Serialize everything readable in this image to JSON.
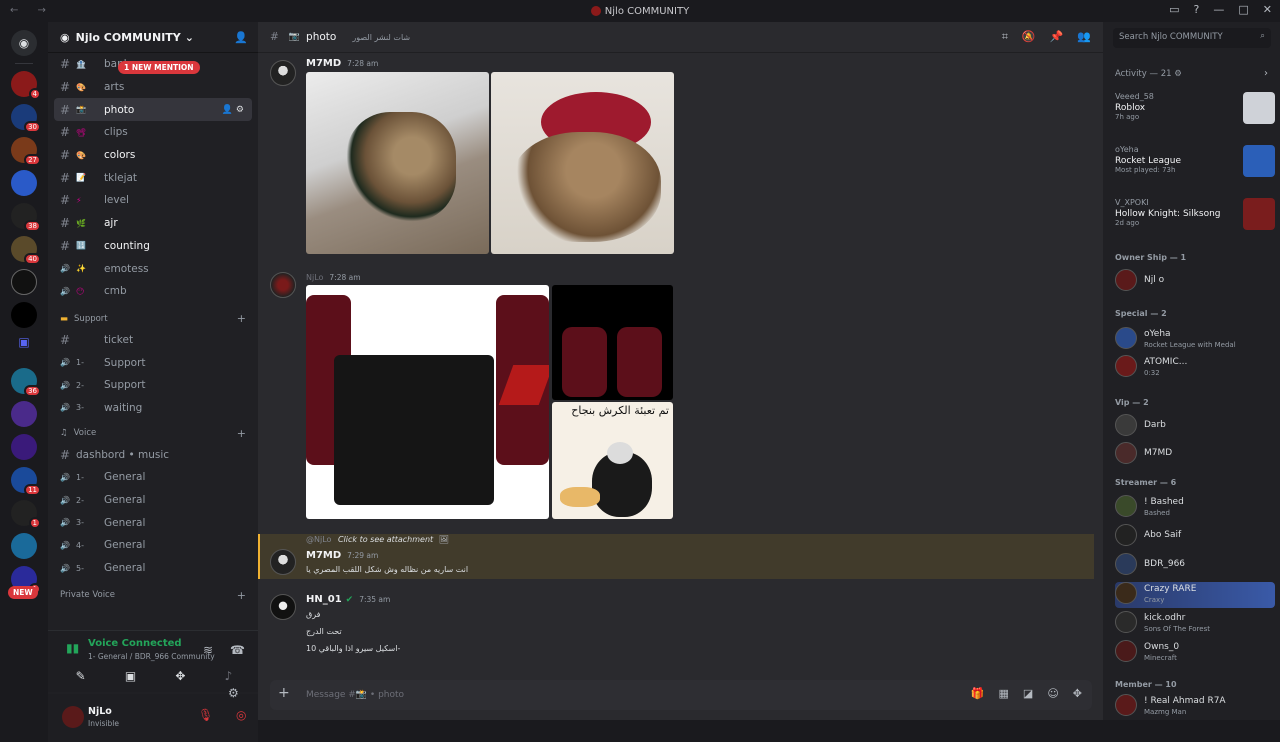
{
  "titlebar": {
    "title": "Njlo COMMUNITY"
  },
  "guild": {
    "name": "Njlo COMMUNITY"
  },
  "pills": {
    "mention": "1 NEW MENTION",
    "new": "NEW"
  },
  "channels": [
    {
      "label": "bank",
      "emoji": "🏦",
      "kind": "text",
      "state": ""
    },
    {
      "label": "arts",
      "emoji": "🎨",
      "kind": "text",
      "state": ""
    },
    {
      "label": "photo",
      "emoji": "📸",
      "kind": "text",
      "state": "sel"
    },
    {
      "label": "clips",
      "emoji": "📽",
      "kind": "text",
      "state": ""
    },
    {
      "label": "colors",
      "emoji": "🎨",
      "kind": "text",
      "state": "bold"
    },
    {
      "label": "tklejat",
      "emoji": "📝",
      "kind": "text",
      "state": ""
    },
    {
      "label": "level",
      "emoji": "⚡",
      "kind": "text",
      "state": ""
    },
    {
      "label": "ajr",
      "emoji": "🌿",
      "kind": "text",
      "state": "bold"
    },
    {
      "label": "counting",
      "emoji": "🔢",
      "kind": "text",
      "state": "bold"
    },
    {
      "label": "emotess",
      "emoji": "✨",
      "kind": "voice",
      "state": ""
    },
    {
      "label": "cmb",
      "emoji": "😶",
      "kind": "voice",
      "state": ""
    }
  ],
  "support_category": {
    "label": "Support"
  },
  "support_channels": [
    {
      "label": "ticket",
      "kind": "text"
    },
    {
      "label": "Support",
      "prefix": "1-",
      "kind": "voice"
    },
    {
      "label": "Support",
      "prefix": "2-",
      "kind": "voice"
    },
    {
      "label": "waiting",
      "prefix": "3-",
      "kind": "voice"
    }
  ],
  "voice_category": {
    "label": "Voice"
  },
  "voice_channels": [
    {
      "label": "dashbord • music"
    },
    {
      "label": "General",
      "prefix": "1-"
    },
    {
      "label": "General",
      "prefix": "2-"
    },
    {
      "label": "General",
      "prefix": "3-"
    },
    {
      "label": "General",
      "prefix": "4-"
    },
    {
      "label": "General",
      "prefix": "5-"
    }
  ],
  "private_voice": {
    "label": "Private Voice"
  },
  "voice_connected": {
    "title": "Voice Connected",
    "subtitle": "1- General / BDR_966 Community"
  },
  "user": {
    "name": "NjLo",
    "status": "Invisible"
  },
  "header": {
    "channel": "photo",
    "topic": "شات لنشر الصور"
  },
  "search": {
    "placeholder": "Search Njlo COMMUNITY"
  },
  "messages": [
    {
      "author": "M7MD",
      "time": "7:28 am"
    },
    {
      "author": "NjLo",
      "time": "7:28 am"
    },
    {
      "author": "M7MD",
      "time": "7:29 am",
      "reply": "Click to see attachment",
      "reply_author": "@NjLo",
      "text": "انت ساريه من نظاله وش شكل اللقب المصري يا"
    },
    {
      "author": "HN_01",
      "time": "7:35 am",
      "lines": [
        "فرق",
        "تحت الدرج",
        "اسكيل سيرو اذا والباقي 10-"
      ]
    }
  ],
  "meme_text": "تم تعبئة الكرش بنجاح",
  "input": {
    "placeholder": "Message #📸 • photo"
  },
  "members": {
    "activity": {
      "title": "Activity — 21"
    },
    "activities": [
      {
        "name": "Veeed_58",
        "game": "Roblox",
        "time": "7h ago",
        "color": "#cfd2d8"
      },
      {
        "name": "oYeha",
        "game": "Rocket League",
        "time": "Most played: 73h",
        "color": "#2b5fb8"
      },
      {
        "name": "V_XPOKI",
        "game": "Hollow Knight: Silksong",
        "time": "2d ago",
        "color": "#7a1d1d"
      }
    ],
    "groups": [
      {
        "title": "Owner Ship — 1",
        "members": [
          {
            "name": "Njl o",
            "sub": ""
          }
        ]
      },
      {
        "title": "Special — 2",
        "members": [
          {
            "name": "oYeha",
            "sub": "Rocket League with Medal"
          },
          {
            "name": "ATOMIC...",
            "sub": "0:32"
          }
        ]
      },
      {
        "title": "Vip — 2",
        "members": [
          {
            "name": "Darb",
            "sub": ""
          },
          {
            "name": "M7MD",
            "sub": ""
          }
        ]
      },
      {
        "title": "Streamer — 6",
        "members": [
          {
            "name": "! Bashed",
            "sub": "Bashed"
          },
          {
            "name": "Abo Saif",
            "sub": ""
          },
          {
            "name": "BDR_966",
            "sub": ""
          },
          {
            "name": "Crazy RARE",
            "sub": "Craxy"
          },
          {
            "name": "kick.odhr",
            "sub": "Sons Of The Forest"
          },
          {
            "name": "Owns_0",
            "sub": "Minecraft"
          }
        ]
      },
      {
        "title": "Member — 10",
        "members": [
          {
            "name": "! Real Ahmad R7A",
            "sub": "Mazmg Man"
          }
        ]
      }
    ]
  }
}
